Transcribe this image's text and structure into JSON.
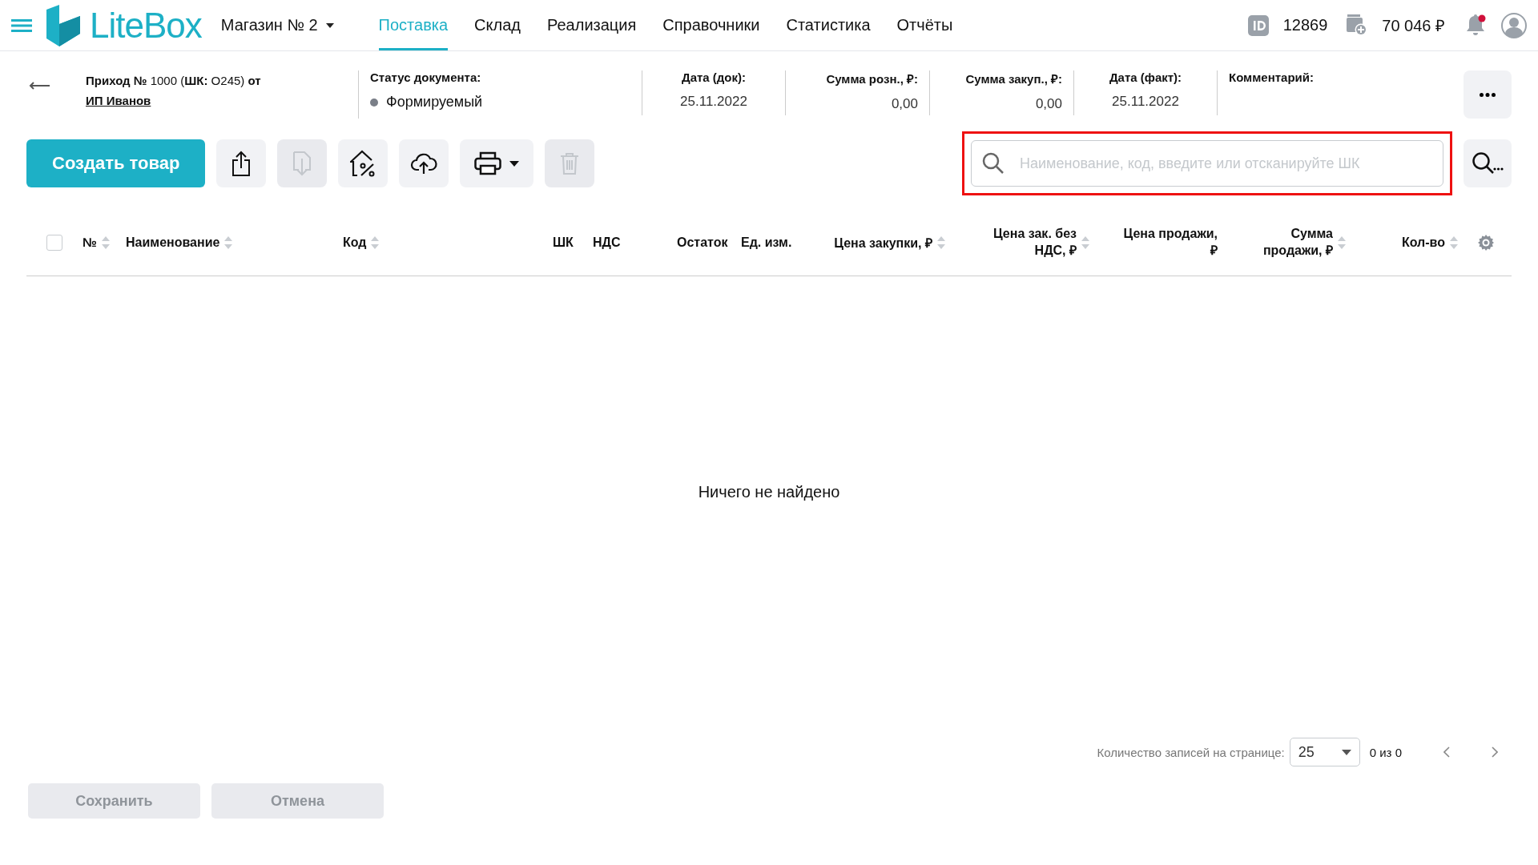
{
  "header": {
    "logo": "LiteBox",
    "store": "Магазин № 2",
    "nav": [
      {
        "label": "Поставка",
        "selected": true
      },
      {
        "label": "Склад",
        "selected": false
      },
      {
        "label": "Реализация",
        "selected": false
      },
      {
        "label": "Справочники",
        "selected": false
      },
      {
        "label": "Статистика",
        "selected": false
      },
      {
        "label": "Отчёты",
        "selected": false
      }
    ],
    "account_id": "12869",
    "balance": "70 046 ₽",
    "notifications_unread": true
  },
  "document": {
    "title": "**Приход №** 1000 (**ШК:** О245) **от**",
    "supplier": "ИП Иванов",
    "fields": [
      {
        "label": "Статус документа:",
        "value": "Формируемый",
        "kind": "status",
        "color": "#7a7f88"
      },
      {
        "label": "Дата (док):",
        "value": "25.11.2022",
        "kind": "center"
      },
      {
        "label": "Сумма розн., ₽:",
        "value": "0,00",
        "kind": "right"
      },
      {
        "label": "Сумма закуп., ₽:",
        "value": "0,00",
        "kind": "right"
      },
      {
        "label": "Дата (факт):",
        "value": "25.11.2022",
        "kind": "center"
      },
      {
        "label": "Комментарий:",
        "kind": "left"
      }
    ]
  },
  "toolbar": {
    "create_button": "Создать товар",
    "tools": [
      {
        "kind": "export",
        "disabled": false
      },
      {
        "kind": "import",
        "disabled": true
      },
      {
        "kind": "discount",
        "disabled": false
      },
      {
        "kind": "upload",
        "disabled": false
      },
      {
        "kind": "print",
        "disabled": false
      },
      {
        "kind": "delete",
        "disabled": true
      }
    ]
  },
  "search": {
    "placeholder": "Наименование, код, введите или отсканируйте ШК",
    "highlighted": true
  },
  "table": {
    "select_all": false,
    "columns": [
      {
        "label": "№",
        "sortable": true
      },
      {
        "label": "Наименование",
        "sortable": true
      },
      {
        "label": "Код",
        "sortable": true
      },
      {
        "label": "ШК",
        "sortable": false
      },
      {
        "label": "НДС",
        "sortable": false
      },
      {
        "label": "Остаток",
        "sortable": false
      },
      {
        "label": "Ед. изм.",
        "sortable": false
      },
      {
        "label": "Цена закупки, ₽",
        "sortable": true
      },
      {
        "label": "Цена зак. без НДС, ₽",
        "sortable": true
      },
      {
        "label": "Цена продажи, ₽",
        "sortable": false
      },
      {
        "label": "Сумма продажи, ₽",
        "sortable": true
      },
      {
        "label": "Кол-во",
        "sortable": true
      }
    ],
    "empty_message": "Ничего не найдено"
  },
  "pagination": {
    "label": "Количество записей на странице:",
    "page_size": "25",
    "range": "0 из 0"
  },
  "footer_buttons": [
    {
      "label": "Сохранить",
      "disabled": true
    },
    {
      "label": "Отмена",
      "disabled": true
    }
  ]
}
